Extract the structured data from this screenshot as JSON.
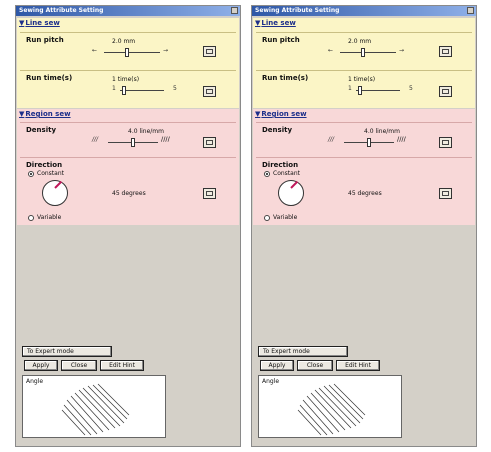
{
  "windows": [
    {
      "title": "Sewing Attribute Setting",
      "line_sew": {
        "heading": "Line sew",
        "run_pitch": {
          "label": "Run pitch",
          "value": "2.0 mm",
          "min_mark": "←",
          "max_mark": "→"
        },
        "run_times": {
          "label": "Run time(s)",
          "value": "1 time(s)",
          "min_mark": "1",
          "max_mark": "5"
        }
      },
      "region_sew": {
        "heading": "Region sew",
        "density": {
          "label": "Density",
          "value": "4.0 line/mm"
        },
        "direction": {
          "label": "Direction",
          "constant": "Constant",
          "degrees": "45 degrees",
          "variable": "Variable"
        }
      },
      "expert_button": "To Expert mode",
      "buttons": {
        "apply": "Apply",
        "close": "Close",
        "edit_hint": "Edit Hint"
      },
      "preview_label": "Angle"
    },
    {
      "title": "Sewing Attribute Setting",
      "line_sew": {
        "heading": "Line sew",
        "run_pitch": {
          "label": "Run pitch",
          "value": "2.0 mm",
          "min_mark": "←",
          "max_mark": "→"
        },
        "run_times": {
          "label": "Run time(s)",
          "value": "1 time(s)",
          "min_mark": "1",
          "max_mark": "5"
        }
      },
      "region_sew": {
        "heading": "Region sew",
        "density": {
          "label": "Density",
          "value": "4.0 line/mm"
        },
        "direction": {
          "label": "Direction",
          "constant": "Constant",
          "degrees": "45 degrees",
          "variable": "Variable"
        }
      },
      "expert_button": "To Expert mode",
      "buttons": {
        "apply": "Apply",
        "close": "Close",
        "edit_hint": "Edit Hint"
      },
      "preview_label": "Angle"
    }
  ]
}
